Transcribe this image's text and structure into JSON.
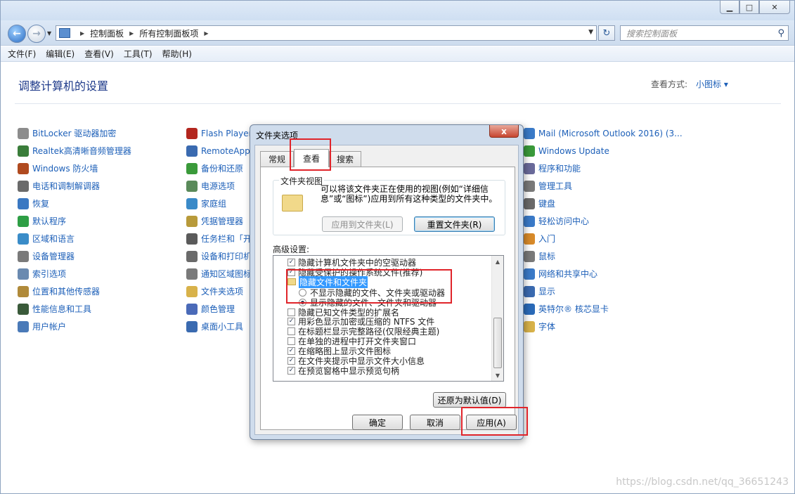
{
  "window": {
    "min_glyph": "▁",
    "max_glyph": "□",
    "close_glyph": "✕"
  },
  "address": {
    "crumbs": [
      "控制面板",
      "所有控制面板项"
    ],
    "search_placeholder": "搜索控制面板"
  },
  "menu": [
    "文件(F)",
    "编辑(E)",
    "查看(V)",
    "工具(T)",
    "帮助(H)"
  ],
  "content": {
    "title": "调整计算机的设置",
    "view_by_label": "查看方式:",
    "view_by_value": "小图标 ▾"
  },
  "cp_columns": [
    {
      "items": [
        {
          "label": "BitLocker 驱动器加密",
          "color": "#8c8c8c"
        },
        {
          "label": "Realtek高清晰音频管理器",
          "color": "#3a7d3a"
        },
        {
          "label": "Windows 防火墙",
          "color": "#b04a1f"
        },
        {
          "label": "电话和调制解调器",
          "color": "#6a6a6a"
        },
        {
          "label": "恢复",
          "color": "#3a78c2"
        },
        {
          "label": "默认程序",
          "color": "#2e9e45"
        },
        {
          "label": "区域和语言",
          "color": "#3a8cc8"
        },
        {
          "label": "设备管理器",
          "color": "#7a7a7a"
        },
        {
          "label": "索引选项",
          "color": "#6a8ab0"
        },
        {
          "label": "位置和其他传感器",
          "color": "#b08a3a"
        },
        {
          "label": "性能信息和工具",
          "color": "#3a5a3a"
        },
        {
          "label": "用户帐户",
          "color": "#4a7ab8"
        }
      ]
    },
    {
      "items": [
        {
          "label": "Flash Player",
          "color": "#b3261e"
        },
        {
          "label": "RemoteApp",
          "color": "#3a6ab0"
        },
        {
          "label": "备份和还原",
          "color": "#3a9a3a"
        },
        {
          "label": "电源选项",
          "color": "#5a8a5a"
        },
        {
          "label": "家庭组",
          "color": "#3a8ac8"
        },
        {
          "label": "凭据管理器",
          "color": "#b89a3a"
        },
        {
          "label": "任务栏和「开",
          "color": "#5a5a5a"
        },
        {
          "label": "设备和打印机",
          "color": "#6a6a6a"
        },
        {
          "label": "通知区域图标",
          "color": "#7a7a7a"
        },
        {
          "label": "文件夹选项",
          "color": "#d8b24a"
        },
        {
          "label": "颜色管理",
          "color": "#4a6ab8"
        },
        {
          "label": "桌面小工具",
          "color": "#3a6ab0"
        }
      ]
    },
    {
      "items": [
        {
          "label": "Mail (Microsoft Outlook 2016) (3...",
          "color": "#3a7ac8"
        },
        {
          "label": "Windows Update",
          "color": "#3a9a3a"
        },
        {
          "label": "程序和功能",
          "color": "#6a6a9a"
        },
        {
          "label": "管理工具",
          "color": "#7a7a7a"
        },
        {
          "label": "键盘",
          "color": "#6a6a6a"
        },
        {
          "label": "轻松访问中心",
          "color": "#3a7ac8"
        },
        {
          "label": "入门",
          "color": "#d88a2a"
        },
        {
          "label": "鼠标",
          "color": "#7a7a7a"
        },
        {
          "label": "网络和共享中心",
          "color": "#3a7ac8"
        },
        {
          "label": "显示",
          "color": "#3a6ab0"
        },
        {
          "label": "英特尔® 核芯显卡",
          "color": "#2a6ab8"
        },
        {
          "label": "字体",
          "color": "#d8b24a"
        }
      ]
    }
  ],
  "dialog": {
    "title": "文件夹选项",
    "close_glyph": "x",
    "tabs": [
      "常规",
      "查看",
      "搜索"
    ],
    "folder_view_legend": "文件夹视图",
    "folder_view_desc": "可以将该文件夹正在使用的视图(例如“详细信息”或“图标”)应用到所有这种类型的文件夹中。",
    "apply_to_folders": "应用到文件夹(L)",
    "reset_folders": "重置文件夹(R)",
    "advanced_label": "高级设置:",
    "rows": [
      {
        "kind": "check",
        "checked": true,
        "label": "隐藏计算机文件夹中的空驱动器"
      },
      {
        "kind": "check",
        "checked": true,
        "label": "隐藏受保护的操作系统文件(推荐)"
      },
      {
        "kind": "folder",
        "label": "隐藏文件和文件夹"
      },
      {
        "kind": "radio",
        "checked": false,
        "label": "不显示隐藏的文件、文件夹或驱动器"
      },
      {
        "kind": "radio",
        "checked": true,
        "label": "显示隐藏的文件、文件夹和驱动器"
      },
      {
        "kind": "check",
        "checked": false,
        "label": "隐藏已知文件类型的扩展名"
      },
      {
        "kind": "check",
        "checked": true,
        "label": "用彩色显示加密或压缩的 NTFS 文件"
      },
      {
        "kind": "check",
        "checked": false,
        "label": "在标题栏显示完整路径(仅限经典主题)"
      },
      {
        "kind": "check",
        "checked": false,
        "label": "在单独的进程中打开文件夹窗口"
      },
      {
        "kind": "check",
        "checked": true,
        "label": "在缩略图上显示文件图标"
      },
      {
        "kind": "check",
        "checked": true,
        "label": "在文件夹提示中显示文件大小信息"
      },
      {
        "kind": "check",
        "checked": true,
        "label": "在预览窗格中显示预览句柄"
      }
    ],
    "restore_defaults": "还原为默认值(D)",
    "ok": "确定",
    "cancel": "取消",
    "apply": "应用(A)"
  },
  "watermark": "https://blog.csdn.net/qq_36651243",
  "highlight_color": "#e0242a"
}
